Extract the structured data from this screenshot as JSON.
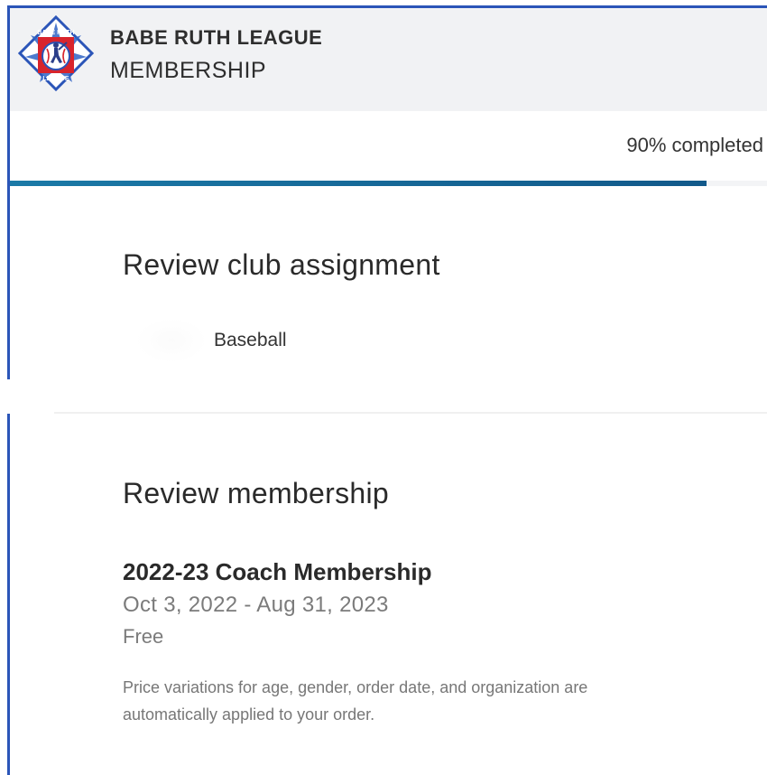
{
  "header": {
    "brand_name": "BABE RUTH LEAGUE",
    "brand_sub": "MEMBERSHIP",
    "logo_text_top": "BABE RUTH",
    "logo_text_bottom": "LEAGUE"
  },
  "progress": {
    "label": "90% completed",
    "fraction": 0.92
  },
  "club_section": {
    "title": "Review club assignment",
    "club_name": "Baseball"
  },
  "membership_section": {
    "title": "Review membership",
    "name": "2022-23 Coach Membership",
    "dates": "Oct 3, 2022 - Aug 31, 2023",
    "price": "Free",
    "note": "Price variations for age, gender, order date, and organization are automatically applied to your order."
  },
  "colors": {
    "frame_blue": "#2b55b8",
    "progress_fill": "#12598a",
    "header_bg": "#f1f2f4"
  }
}
